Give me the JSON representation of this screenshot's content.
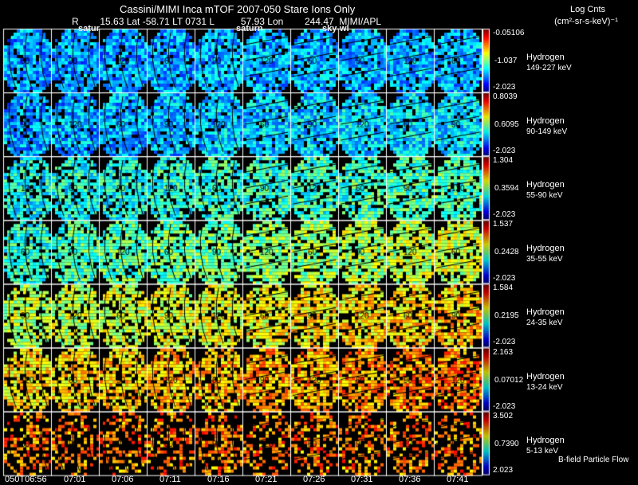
{
  "header": {
    "title": "Cassini/MIMI Inca mTOF  2007-050   Stare   Ions Only",
    "subtitle": "R        15.63 Lat -58.71 LT 0731 L          57.93 Lon        244.47  MIMI/APL",
    "colorbar_title": "Log Cnts",
    "colorbar_units": "(cm²-sr-s-keV)⁻¹"
  },
  "annotations": [
    "satur",
    "saturn",
    "sky-wl"
  ],
  "footer_note": "B-field Particle Flow",
  "chart_data": {
    "type": "heatmap",
    "colormap": "jet",
    "x_tick_labels": [
      "050T06:56",
      "07:01",
      "07:06",
      "07:11",
      "07:16",
      "07:21",
      "07:26",
      "07:31",
      "07:36",
      "07:41"
    ],
    "contour_labels": [
      "60",
      "90",
      "120"
    ],
    "rows": [
      {
        "species": "Hydrogen",
        "energy": "149-227 keV",
        "cmax": "-0.05106",
        "cmid": "-1.037",
        "cmin": "-2.023"
      },
      {
        "species": "Hydrogen",
        "energy": "90-149 keV",
        "cmax": "0.8039",
        "cmid": "0.6095",
        "cmin": "-2.023"
      },
      {
        "species": "Hydrogen",
        "energy": "55-90 keV",
        "cmax": "1.304",
        "cmid": "0.3594",
        "cmin": "-2.023"
      },
      {
        "species": "Hydrogen",
        "energy": "35-55 keV",
        "cmax": "1.537",
        "cmid": "0.2428",
        "cmin": "-2.023"
      },
      {
        "species": "Hydrogen",
        "energy": "24-35 keV",
        "cmax": "1.584",
        "cmid": "0.2195",
        "cmin": "-2.023"
      },
      {
        "species": "Hydrogen",
        "energy": "13-24 keV",
        "cmax": "2.163",
        "cmid": "0.07012",
        "cmin": "-2.023"
      },
      {
        "species": "Hydrogen",
        "energy": "5-13 keV",
        "cmax": "3.502",
        "cmid": "0.7390",
        "cmin": "2.023"
      }
    ]
  }
}
